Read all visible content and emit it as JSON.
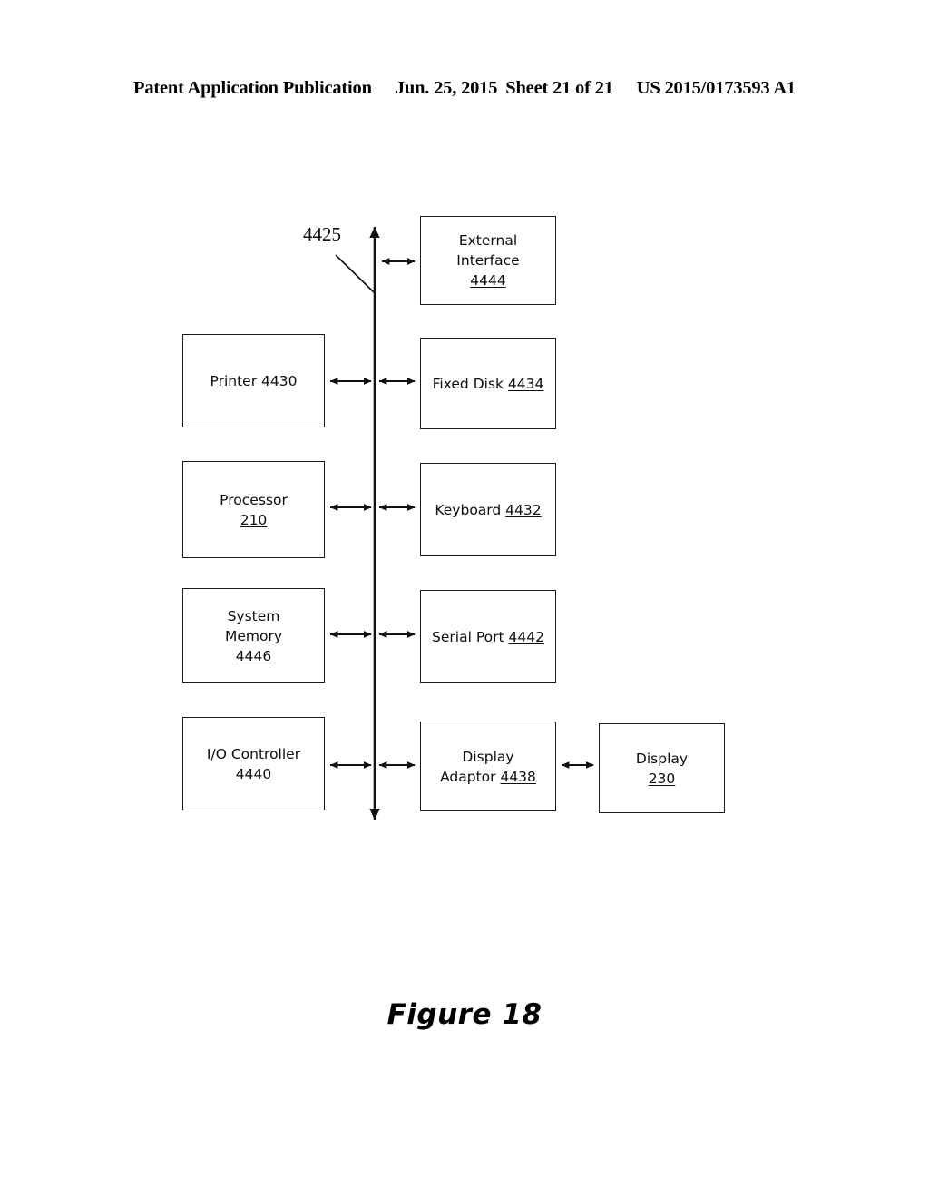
{
  "header": {
    "publication": "Patent Application Publication",
    "date": "Jun. 25, 2015",
    "sheet": "Sheet 21 of 21",
    "number": "US 2015/0173593 A1"
  },
  "figure": {
    "caption": "Figure 18",
    "bus_label": "4425"
  },
  "nodes": {
    "external_interface": {
      "line1": "External",
      "line2": "Interface",
      "ref": "4444"
    },
    "printer": {
      "line1": "Printer ",
      "ref": "4430"
    },
    "fixed_disk": {
      "line1": "Fixed Disk ",
      "ref": "4434"
    },
    "processor": {
      "line1": "Processor",
      "ref": "210"
    },
    "keyboard": {
      "line1": "Keyboard ",
      "ref": "4432"
    },
    "system_memory": {
      "line1": "System",
      "line2": "Memory",
      "ref": "4446"
    },
    "serial_port": {
      "line1": "Serial Port ",
      "ref": "4442"
    },
    "io_controller": {
      "line1": "I/O Controller",
      "ref": "4440"
    },
    "display_adaptor": {
      "line1": "Display",
      "line2": "Adaptor ",
      "ref": "4438"
    },
    "display": {
      "line1": "Display",
      "ref": "230"
    }
  },
  "colors": {
    "stroke": "#1a1a1a",
    "text": "#0d0d0d",
    "background": "#ffffff"
  }
}
